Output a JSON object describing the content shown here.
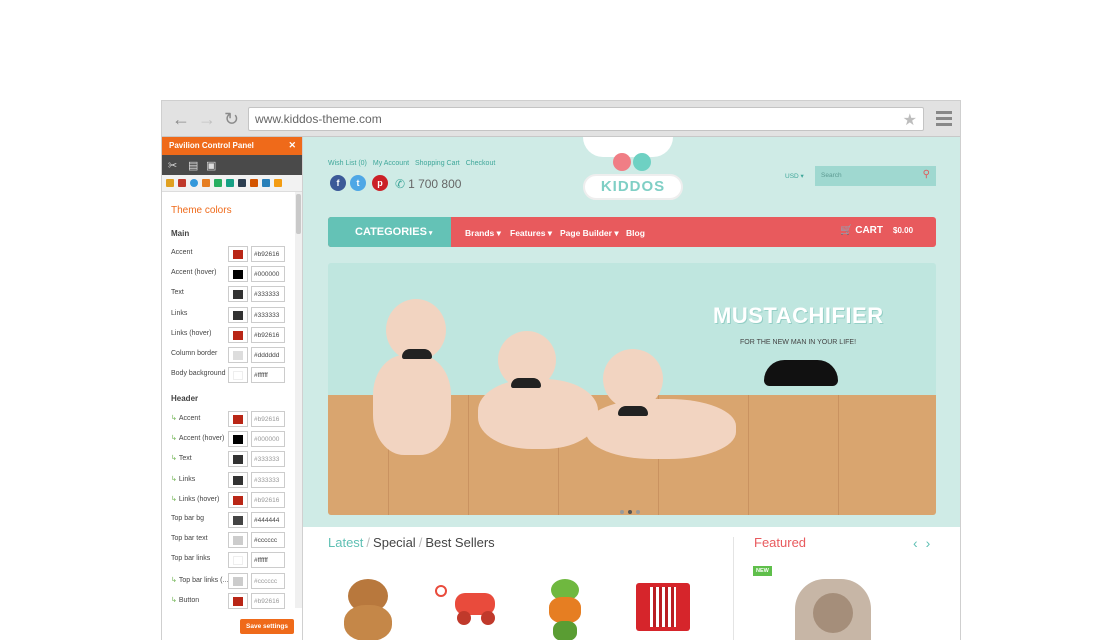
{
  "browser": {
    "url": "www.kiddos-theme.com"
  },
  "panel": {
    "title": "Pavilion Control Panel",
    "section_title": "Theme colors",
    "main_heading": "Main",
    "header_heading": "Header",
    "main_rows": [
      {
        "label": "Accent",
        "value": "#b92616",
        "color": "#b92616"
      },
      {
        "label": "Accent (hover)",
        "value": "#000000",
        "color": "#000000"
      },
      {
        "label": "Text",
        "value": "#333333",
        "color": "#333333"
      },
      {
        "label": "Links",
        "value": "#333333",
        "color": "#333333"
      },
      {
        "label": "Links (hover)",
        "value": "#b92616",
        "color": "#b92616"
      },
      {
        "label": "Column border",
        "value": "#dddddd",
        "color": "#dddddd"
      },
      {
        "label": "Body background",
        "value": "#ffffff",
        "color": "#ffffff"
      }
    ],
    "header_rows": [
      {
        "label": "Accent",
        "value": "#b92616",
        "color": "#b92616",
        "inherited": true
      },
      {
        "label": "Accent (hover)",
        "value": "#000000",
        "color": "#000000",
        "inherited": true
      },
      {
        "label": "Text",
        "value": "#333333",
        "color": "#333333",
        "inherited": true
      },
      {
        "label": "Links",
        "value": "#333333",
        "color": "#333333",
        "inherited": true
      },
      {
        "label": "Links (hover)",
        "value": "#b92616",
        "color": "#b92616",
        "inherited": true
      },
      {
        "label": "Top bar bg",
        "value": "#444444",
        "color": "#444444",
        "inherited": false
      },
      {
        "label": "Top bar text",
        "value": "#cccccc",
        "color": "#cccccc",
        "inherited": false
      },
      {
        "label": "Top bar links",
        "value": "#ffffff",
        "color": "#ffffff",
        "inherited": false
      },
      {
        "label": "Top bar links (...",
        "value": "#cccccc",
        "color": "#cccccc",
        "inherited": true
      },
      {
        "label": "Button",
        "value": "#b92616",
        "color": "#b92616",
        "inherited": true
      }
    ],
    "save_label": "Save settings"
  },
  "site": {
    "top_links": [
      "Wish List (0)",
      "My Account",
      "Shopping Cart",
      "Checkout"
    ],
    "phone": "1 700 800",
    "logo": "KIDDOS",
    "currency": "USD",
    "search_placeholder": "Search",
    "categories_label": "CATEGORIES",
    "nav": [
      "Brands",
      "Features",
      "Page Builder",
      "Blog"
    ],
    "cart_label": "CART",
    "cart_total": "$0.00",
    "slide_title": "MUSTACHIFIER",
    "slide_subtitle": "FOR THE NEW MAN IN YOUR LIFE!",
    "tabs": [
      "Latest",
      "Special",
      "Best Sellers"
    ],
    "featured_title": "Featured",
    "new_badge": "NEW"
  },
  "colors": {
    "accent_orange": "#ef6a1a",
    "teal": "#64c2b6",
    "coral": "#e85a5d",
    "bg_mint": "#cfebe6"
  }
}
